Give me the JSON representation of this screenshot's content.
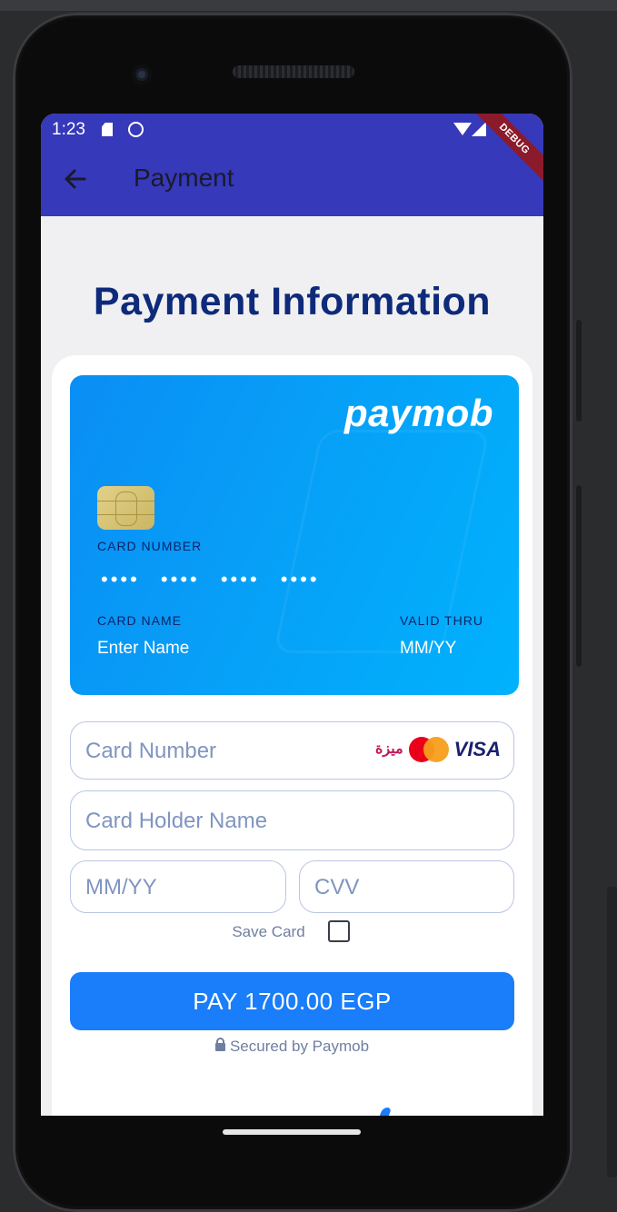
{
  "status_bar": {
    "time": "1:23",
    "debug_label": "DEBUG"
  },
  "app_bar": {
    "title": "Payment"
  },
  "page": {
    "title": "Payment Information"
  },
  "card": {
    "brand": "paymob",
    "number_label": "CARD NUMBER",
    "number_mask": "•••• •••• •••• ••••",
    "name_label": "CARD NAME",
    "name_value": "Enter Name",
    "valid_label": "VALID THRU",
    "valid_value": "MM/YY"
  },
  "form": {
    "card_number_placeholder": "Card Number",
    "holder_name_placeholder": "Card Holder Name",
    "expiry_placeholder": "MM/YY",
    "cvv_placeholder": "CVV",
    "logos": {
      "meeza": "ميزة",
      "visa": "VISA"
    },
    "save_card_label": "Save Card",
    "pay_button": "PAY 1700.00 EGP",
    "secured_text": "Secured by Paymob"
  },
  "colors": {
    "app_bar": "#3639b9",
    "title": "#0e2a7a",
    "card_gradient_start": "#0a8ef4",
    "card_gradient_end": "#00b2fd",
    "pay_button": "#1a7dfa"
  },
  "icons": [
    "back-arrow-icon",
    "sd-card-icon",
    "face-icon",
    "wifi-icon",
    "signal-icon",
    "battery-icon",
    "lock-icon",
    "chip-icon"
  ]
}
